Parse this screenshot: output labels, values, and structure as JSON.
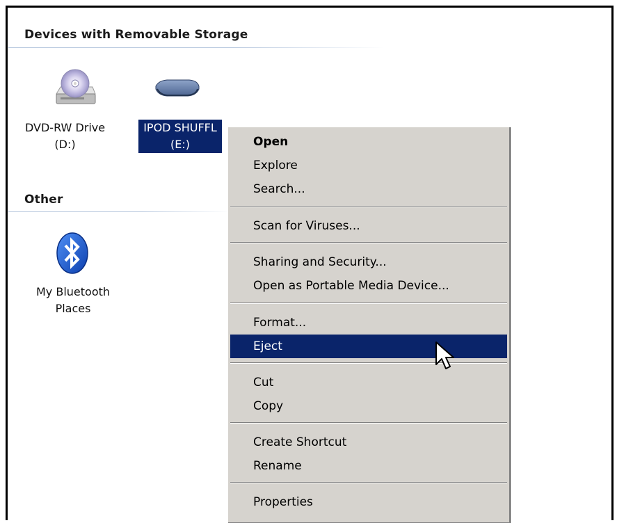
{
  "groups": {
    "removable": {
      "title": "Devices with Removable Storage"
    },
    "other": {
      "title": "Other"
    }
  },
  "devices": [
    {
      "name_line1": "DVD-RW Drive",
      "name_line2": "(D:)",
      "icon": "dvd-drive-icon",
      "selected": false
    },
    {
      "name_line1": "IPOD SHUFFL",
      "name_line2": "(E:)",
      "icon": "removable-drive-icon",
      "selected": true
    }
  ],
  "other_items": [
    {
      "name_line1": "My Bluetooth",
      "name_line2": "Places",
      "icon": "bluetooth-icon"
    }
  ],
  "context_menu": {
    "items": [
      {
        "label": "Open",
        "bold": true
      },
      {
        "label": "Explore"
      },
      {
        "label": "Search..."
      },
      {
        "label": "Scan for Viruses..."
      },
      {
        "label": "Sharing and Security..."
      },
      {
        "label": "Open as Portable Media Device..."
      },
      {
        "label": "Format..."
      },
      {
        "label": "Eject",
        "highlighted": true
      },
      {
        "label": "Cut"
      },
      {
        "label": "Copy"
      },
      {
        "label": "Create Shortcut"
      },
      {
        "label": "Rename"
      },
      {
        "label": "Properties"
      }
    ]
  },
  "colors": {
    "selection": "#0a246a",
    "menu_background": "#d6d3ce",
    "bluetooth": "#1a5fd6"
  }
}
